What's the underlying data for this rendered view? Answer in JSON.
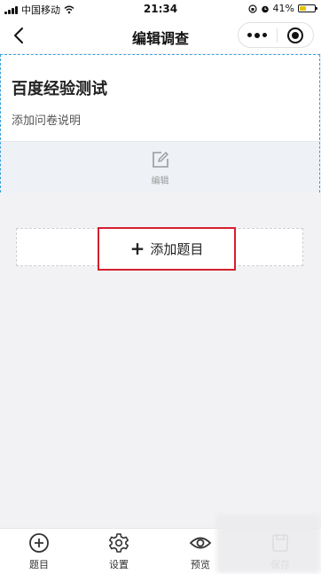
{
  "status_bar": {
    "carrier": "中国移动",
    "time": "21:34",
    "battery": "41%"
  },
  "nav": {
    "title": "编辑调查"
  },
  "survey": {
    "title": "百度经验测试",
    "description": "添加问卷说明",
    "edit_label": "编辑"
  },
  "add_question": {
    "label": "添加题目"
  },
  "tab_bar": {
    "items": [
      {
        "label": "题目",
        "icon": "plus-circle-icon"
      },
      {
        "label": "设置",
        "icon": "gear-icon"
      },
      {
        "label": "预览",
        "icon": "eye-icon"
      },
      {
        "label": "保存",
        "icon": "save-icon"
      }
    ]
  },
  "colors": {
    "accent_border": "#3d9fd9",
    "highlight": "#d5202f",
    "battery": "#e6c200"
  }
}
